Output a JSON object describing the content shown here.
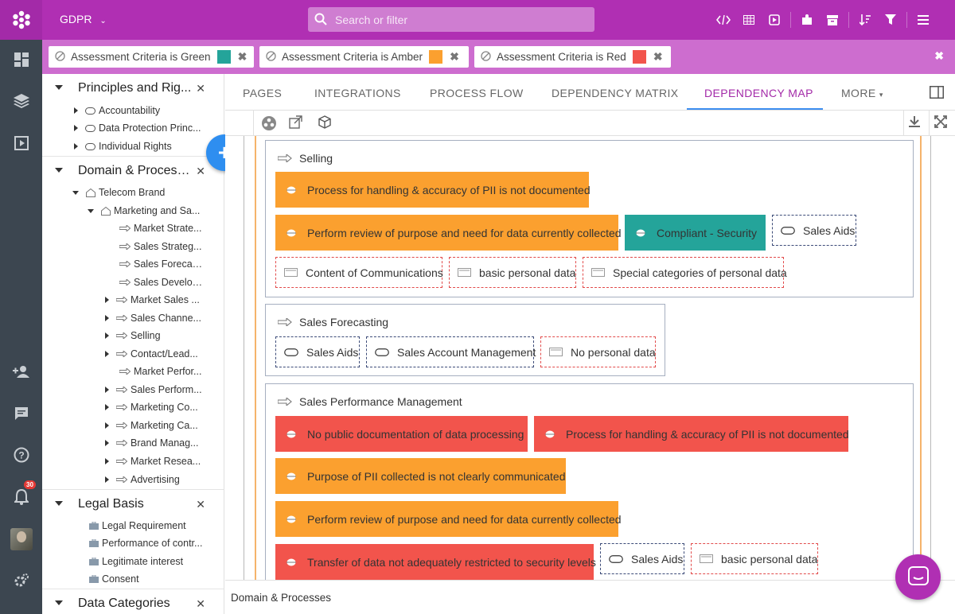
{
  "app": {
    "title": "GDPR"
  },
  "search": {
    "placeholder": "Search or filter"
  },
  "filters": [
    {
      "label": "Assessment Criteria is Green",
      "color": "#24a49a"
    },
    {
      "label": "Assessment Criteria is Amber",
      "color": "#fba02f"
    },
    {
      "label": "Assessment Criteria is Red",
      "color": "#f2544c"
    }
  ],
  "sidebar": {
    "sections": [
      {
        "title": "Principles and Rig...",
        "items": [
          "Accountability",
          "Data Protection Princ...",
          "Individual Rights"
        ]
      },
      {
        "title": "Domain & Process...",
        "items": [
          "Telecom Brand",
          "Marketing and Sa...",
          "Market Strate...",
          "Sales Strateg...",
          "Sales Forecas...",
          "Sales Develop...",
          "Market Sales ...",
          "Sales Channe...",
          "Selling",
          "Contact/Lead...",
          "Market Perfor...",
          "Sales Perform...",
          "Marketing Co...",
          "Marketing Ca...",
          "Brand Manag...",
          "Market Resea...",
          "Advertising"
        ]
      },
      {
        "title": "Legal Basis",
        "items": [
          "Legal Requirement",
          "Performance of contr...",
          "Legitimate interest",
          "Consent"
        ]
      },
      {
        "title": "Data Categories",
        "items": []
      }
    ]
  },
  "tabs": [
    "PAGES",
    "INTEGRATIONS",
    "PROCESS FLOW",
    "DEPENDENCY MATRIX",
    "DEPENDENCY MAP",
    "MORE"
  ],
  "active_tab": "DEPENDENCY MAP",
  "map": {
    "groups": [
      {
        "title": "Selling",
        "items": [
          {
            "label": "Process for handling & accuracy of PII is not documented",
            "kind": "orange"
          },
          {
            "label": "Perform review of purpose and need for data currently collected",
            "kind": "orange"
          },
          {
            "label": "Compliant - Security",
            "kind": "teal"
          },
          {
            "label": "Sales Aids",
            "kind": "app"
          },
          {
            "label": "Content of Communications",
            "kind": "data"
          },
          {
            "label": "basic personal data",
            "kind": "data"
          },
          {
            "label": "Special categories of personal data",
            "kind": "data"
          }
        ]
      },
      {
        "title": "Sales Forecasting",
        "items": [
          {
            "label": "Sales Aids",
            "kind": "app"
          },
          {
            "label": "Sales Account Management",
            "kind": "app"
          },
          {
            "label": "No personal data",
            "kind": "data"
          }
        ]
      },
      {
        "title": "Sales Performance Management",
        "items": [
          {
            "label": "No public documentation of data processing",
            "kind": "red"
          },
          {
            "label": "Process for handling & accuracy of PII is not documented",
            "kind": "red"
          },
          {
            "label": "Purpose of PII collected is not clearly communicated",
            "kind": "orange"
          },
          {
            "label": "Perform review of purpose and need for data currently collected",
            "kind": "orange"
          },
          {
            "label": "Transfer of data not adequately restricted to security levels",
            "kind": "red"
          },
          {
            "label": "Sales Aids",
            "kind": "app"
          },
          {
            "label": "basic personal data",
            "kind": "data"
          }
        ]
      }
    ]
  },
  "statusbar": {
    "text": "Domain & Processes"
  },
  "notifications": {
    "count": "30"
  }
}
